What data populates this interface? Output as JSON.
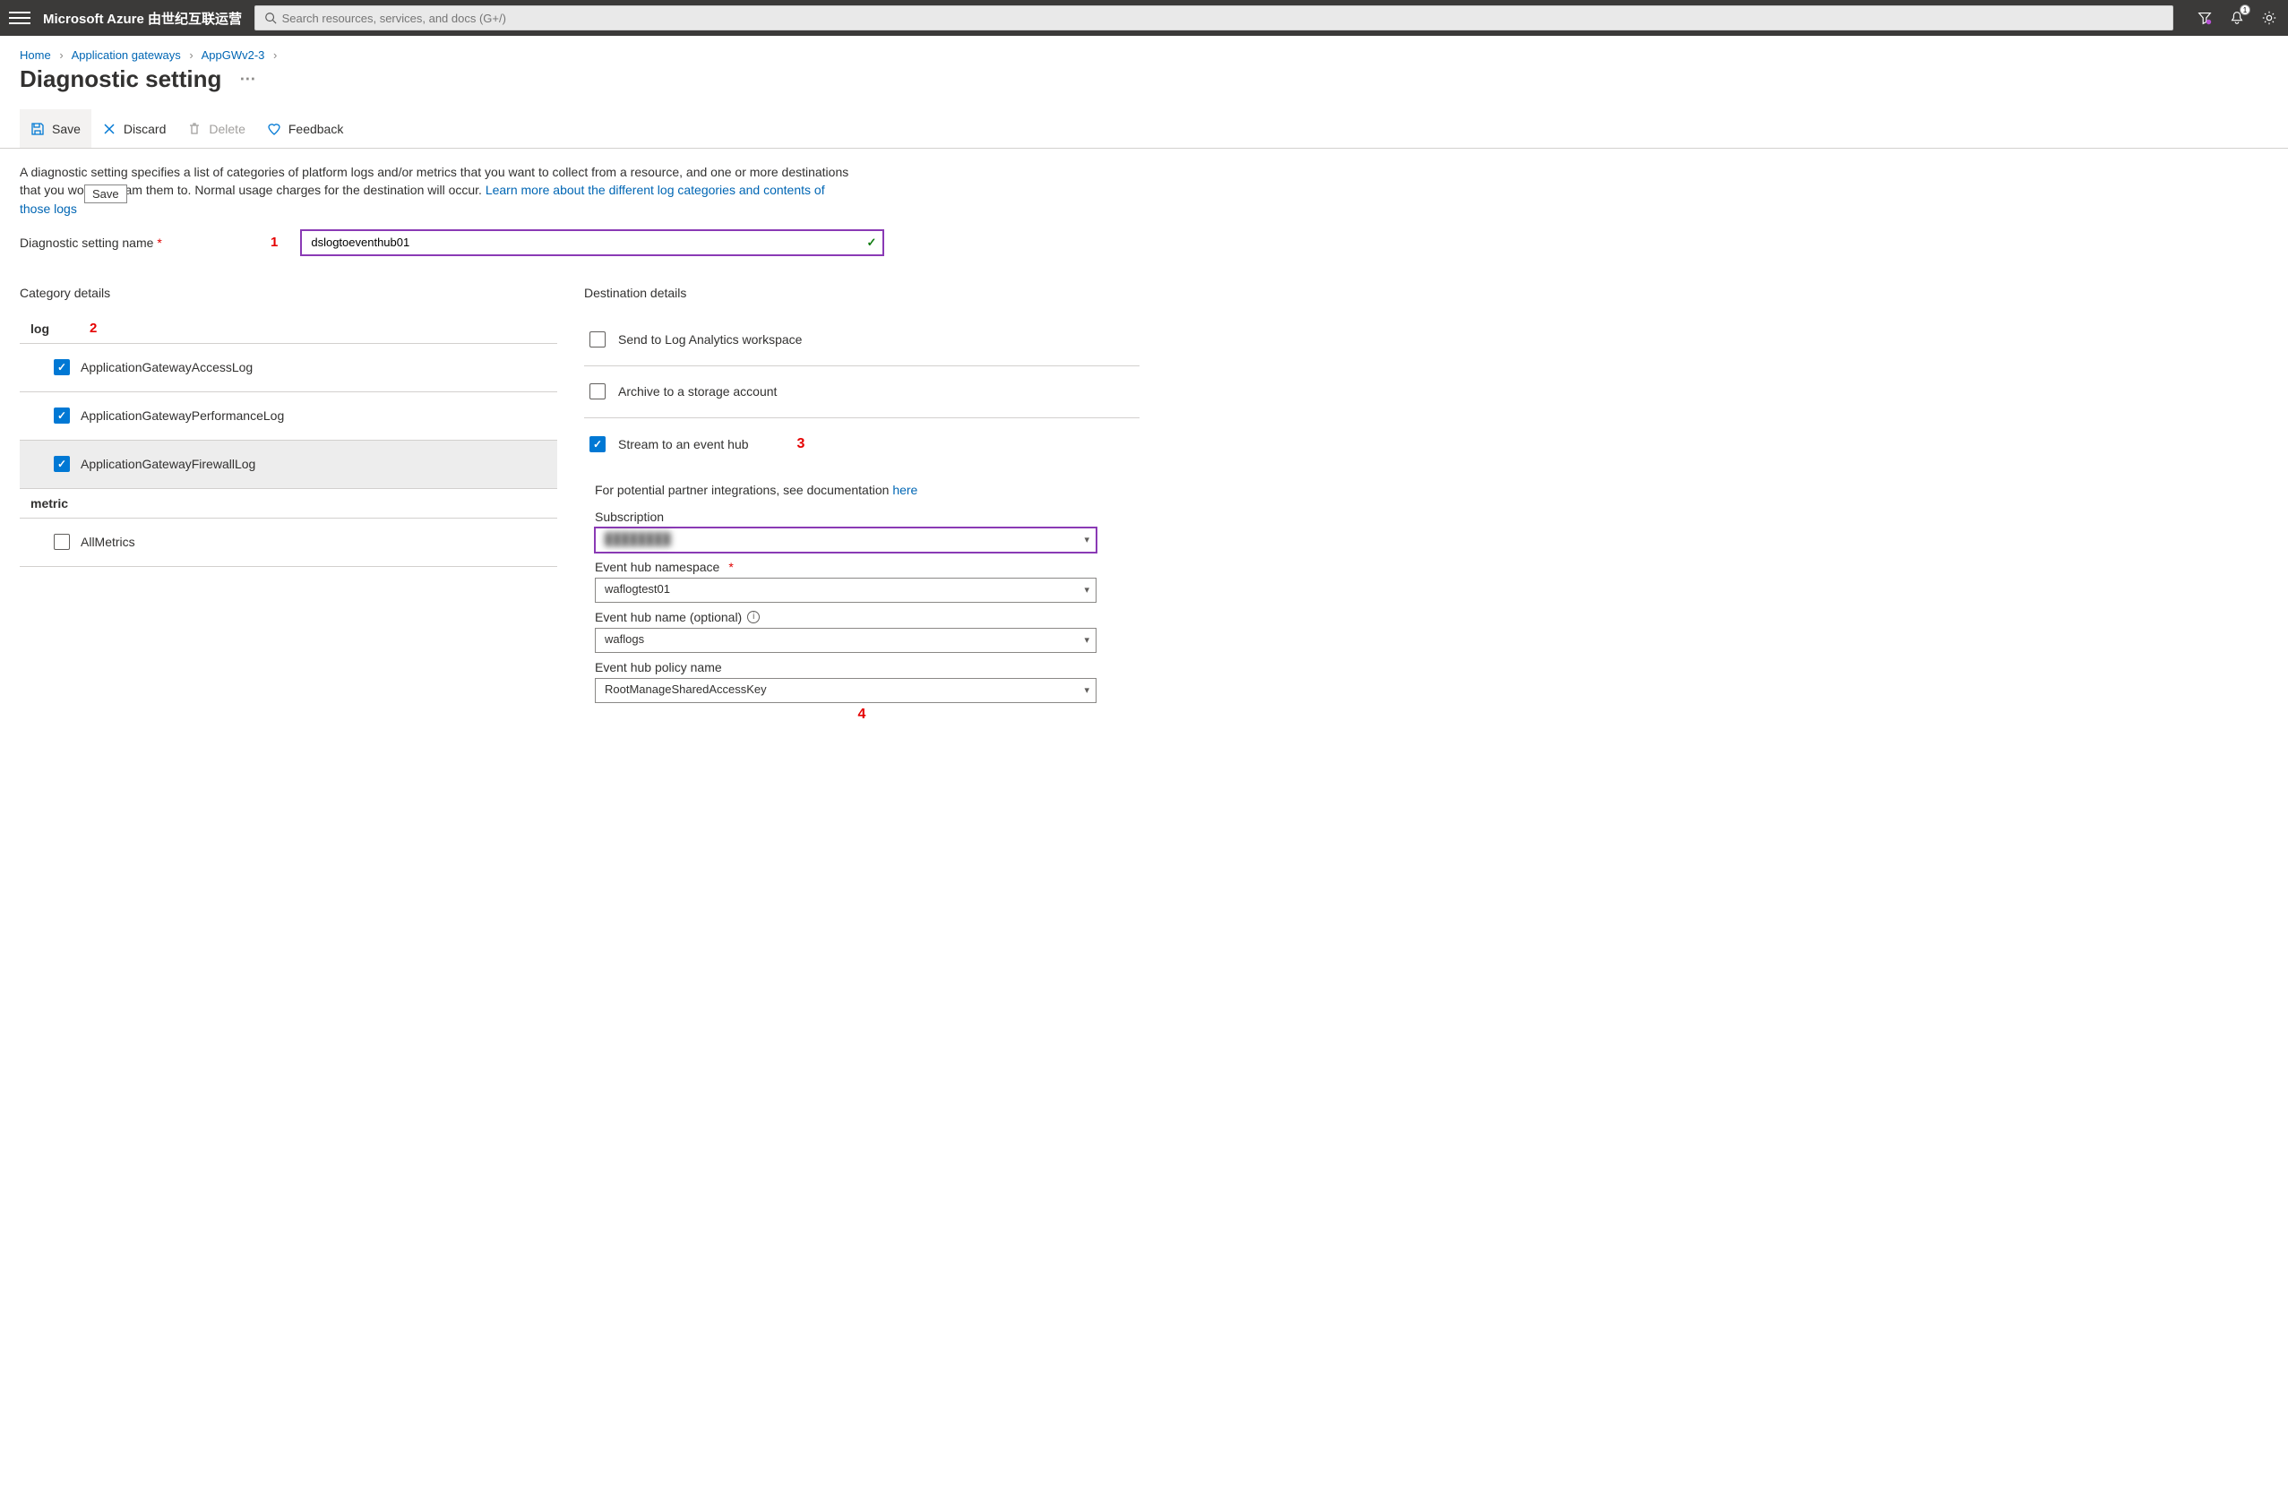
{
  "topbar": {
    "brand": "Microsoft Azure 由世纪互联运营",
    "search_placeholder": "Search resources, services, and docs (G+/)",
    "notification_badge": "1"
  },
  "breadcrumbs": {
    "home": "Home",
    "level1": "Application gateways",
    "level2": "AppGWv2-3"
  },
  "page": {
    "title": "Diagnostic setting"
  },
  "cmd": {
    "save": "Save",
    "discard": "Discard",
    "delete": "Delete",
    "feedback": "Feedback",
    "save_tooltip": "Save"
  },
  "desc": {
    "text_a": "A diagnostic setting specifies a list of categories of platform logs and/or metrics that you want to collect from a resource, and one or more destinations that you would stream them to. Normal usage charges for the destination will occur. ",
    "link": "Learn more about the different log categories and contents of those logs"
  },
  "name_field": {
    "label": "Diagnostic setting name",
    "value": "dslogtoeventhub01",
    "marker": "1"
  },
  "categories": {
    "title": "Category details",
    "log_header": "log",
    "log_marker": "2",
    "log_items": [
      {
        "label": "ApplicationGatewayAccessLog",
        "checked": true,
        "highlight": false
      },
      {
        "label": "ApplicationGatewayPerformanceLog",
        "checked": true,
        "highlight": false
      },
      {
        "label": "ApplicationGatewayFirewallLog",
        "checked": true,
        "highlight": true
      }
    ],
    "metric_header": "metric",
    "metric_items": [
      {
        "label": "AllMetrics",
        "checked": false
      }
    ]
  },
  "destinations": {
    "title": "Destination details",
    "items": [
      {
        "label": "Send to Log Analytics workspace",
        "checked": false
      },
      {
        "label": "Archive to a storage account",
        "checked": false
      },
      {
        "label": "Stream to an event hub",
        "checked": true
      }
    ],
    "marker3": "3",
    "partner_hint_a": "For potential partner integrations, see documentation ",
    "partner_hint_link": "here",
    "subscription": {
      "label": "Subscription",
      "value": "████████"
    },
    "namespace": {
      "label": "Event hub namespace",
      "value": "waflogtest01"
    },
    "hubname": {
      "label": "Event hub name (optional)",
      "value": "waflogs"
    },
    "policy": {
      "label": "Event hub policy name",
      "value": "RootManageSharedAccessKey"
    },
    "marker4": "4"
  }
}
